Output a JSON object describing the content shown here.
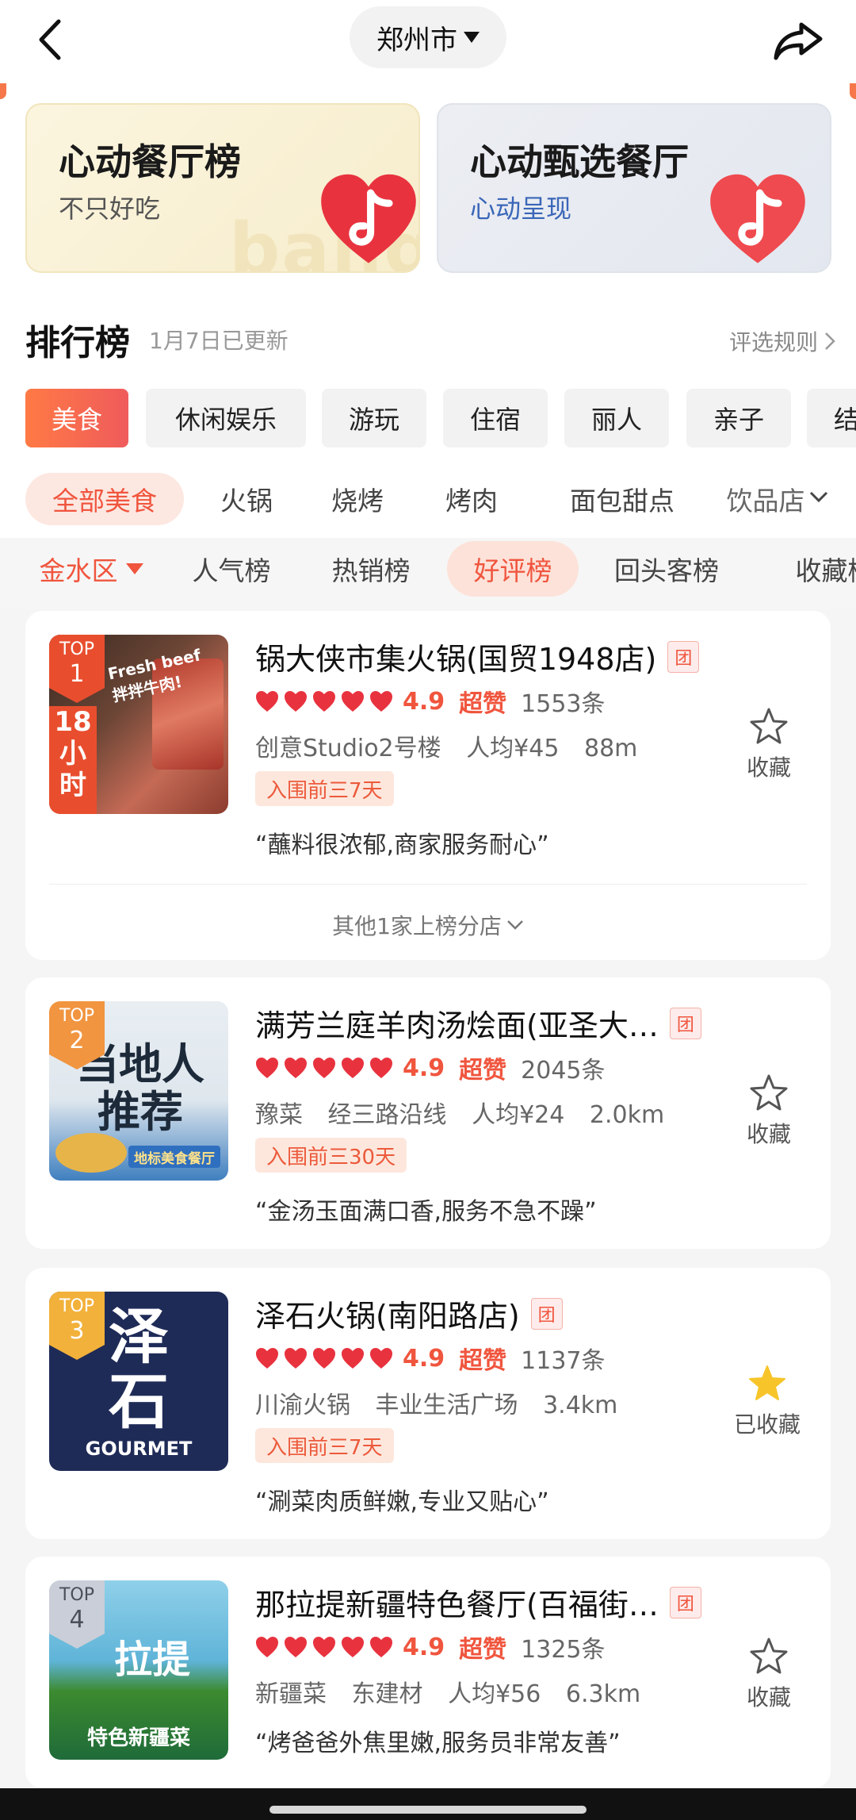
{
  "header": {
    "city": "郑州市"
  },
  "banners": [
    {
      "title": "心动餐厅榜",
      "subtitle": "不只好吃",
      "bg_word": "bang!"
    },
    {
      "title": "心动甄选餐厅",
      "subtitle": "心动呈现"
    }
  ],
  "ranking": {
    "title": "排行榜",
    "updated": "1月7日已更新",
    "rule_link": "评选规则"
  },
  "categories": [
    "美食",
    "休闲娱乐",
    "游玩",
    "住宿",
    "丽人",
    "亲子",
    "结"
  ],
  "subcategories": [
    "全部美食",
    "火锅",
    "烧烤",
    "烤肉",
    "面包甜点",
    "饮品店"
  ],
  "filters": {
    "district": "金水区",
    "lists": [
      "人气榜",
      "热销榜",
      "好评榜",
      "回头客榜",
      "收藏榜"
    ]
  },
  "restaurants": [
    {
      "rank_label": "TOP",
      "rank": "1",
      "name": "锅大侠市集火锅(国贸1948店)",
      "tuan": "团",
      "score": "4.9",
      "praise": "超赞",
      "count": "1553条",
      "meta": [
        "创意Studio2号楼",
        "人均¥45",
        "88m"
      ],
      "tag": "入围前三7天",
      "quote": "“蘸料很浓郁,商家服务耐心”",
      "fav_label": "收藏",
      "favorited": false,
      "more": "其他1家上榜分店",
      "thumb_text": [
        "18",
        "小",
        "时"
      ],
      "thumb_side": "Fresh beef 拌拌牛肉!"
    },
    {
      "rank_label": "TOP",
      "rank": "2",
      "name": "满芳兰庭羊肉汤烩面(亚圣大…",
      "tuan": "团",
      "score": "4.9",
      "praise": "超赞",
      "count": "2045条",
      "meta": [
        "豫菜",
        "经三路沿线",
        "人均¥24",
        "2.0km"
      ],
      "tag": "入围前三30天",
      "quote": "“金汤玉面满口香,服务不急不躁”",
      "fav_label": "收藏",
      "favorited": false,
      "thumb_text": [
        "当地人",
        "推荐"
      ],
      "thumb_side": "地标美食餐厅"
    },
    {
      "rank_label": "TOP",
      "rank": "3",
      "name": "泽石火锅(南阳路店)",
      "tuan": "团",
      "score": "4.9",
      "praise": "超赞",
      "count": "1137条",
      "meta": [
        "川渝火锅",
        "丰业生活广场",
        "3.4km"
      ],
      "tag": "入围前三7天",
      "quote": "“涮菜肉质鲜嫩,专业又贴心”",
      "fav_label": "已收藏",
      "favorited": true,
      "thumb_text": [
        "泽",
        "石"
      ],
      "thumb_side": "GOURMET"
    },
    {
      "rank_label": "TOP",
      "rank": "4",
      "name": "那拉提新疆特色餐厅(百福街…",
      "tuan": "团",
      "score": "4.9",
      "praise": "超赞",
      "count": "1325条",
      "meta": [
        "新疆菜",
        "东建材",
        "人均¥56",
        "6.3km"
      ],
      "quote": "“烤爸爸外焦里嫩,服务员非常友善”",
      "fav_label": "收藏",
      "favorited": false,
      "thumb_text": [
        "拉提"
      ],
      "thumb_side": "特色新疆菜"
    }
  ],
  "colors": {
    "accent": "#f0553e",
    "heart": "#e8333f"
  }
}
